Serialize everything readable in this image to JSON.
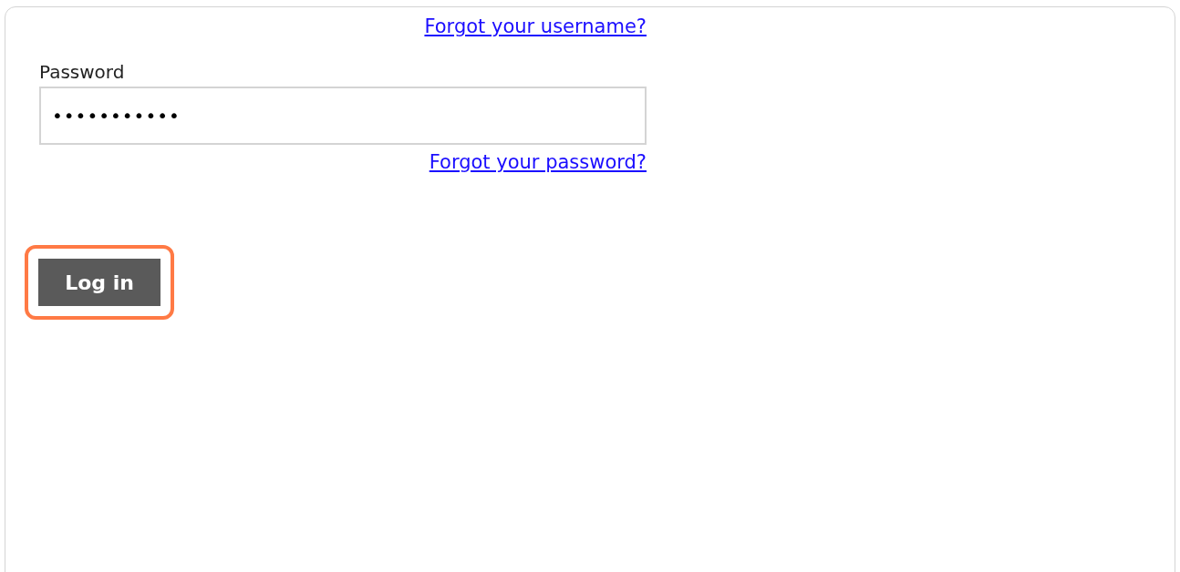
{
  "username_help_link": "Forgot your username?",
  "password": {
    "label": "Password",
    "value": "•••••••••••"
  },
  "password_help_link": "Forgot your password?",
  "login_button": {
    "label": "Log in",
    "highlighted": true
  }
}
